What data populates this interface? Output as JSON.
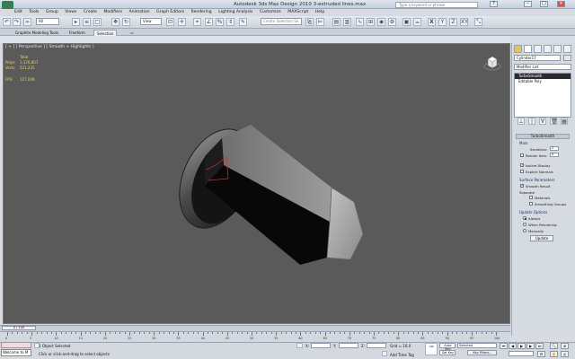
{
  "window": {
    "title": "Autodesk 3ds Max Design 2010     3-extruded lines.max",
    "search_placeholder": "Type a keyword or phrase"
  },
  "menus": [
    "Edit",
    "Tools",
    "Group",
    "Views",
    "Create",
    "Modifiers",
    "Animation",
    "Graph Editors",
    "Rendering",
    "Lighting Analysis",
    "Customize",
    "MAXScript",
    "Help"
  ],
  "toolbar": {
    "filter_value": "All",
    "refcoord_value": "View",
    "named_selection_placeholder": "Create Selection Se",
    "axis_x": "X",
    "axis_y": "Y",
    "axis_z": "Z",
    "axis_xy": "XY"
  },
  "ribbon": {
    "tabs": [
      "Graphite Modeling Tools",
      "Freeform",
      "Selection"
    ]
  },
  "viewport": {
    "label": "[ + ] [ Perspective ] [ Smooth + Highlights ]",
    "stats_total": "Total",
    "stats_polys_label": "Polys:",
    "stats_polys": "1,376,807",
    "stats_verts_label": "Verts:",
    "stats_verts": "521,235",
    "fps_label": "FPS:",
    "fps": "127.049"
  },
  "command_panel": {
    "object_name": "Cylinder17",
    "modifier_list": "Modifier List",
    "stack": [
      "TurboSmooth",
      "Editable Poly"
    ],
    "rollout_title": "TurboSmooth",
    "main_label": "Main",
    "iterations_label": "Iterations:",
    "iterations_value": "2",
    "render_iters_label": "Render Iters:",
    "render_iters_value": "0",
    "isoline_label": "Isoline Display",
    "explicit_normals_label": "Explicit Normals",
    "surface_params_label": "Surface Parameters",
    "smooth_result_label": "Smooth Result",
    "separate_label": "Separate",
    "materials_label": "Materials",
    "smoothing_groups_label": "Smoothing Groups",
    "update_options_label": "Update Options",
    "always_label": "Always",
    "when_rendering_label": "When Rendering",
    "manually_label": "Manually",
    "update_button": "Update"
  },
  "timeline": {
    "slider_label": "0 / 100",
    "ticks": [
      "0",
      "5",
      "10",
      "15",
      "20",
      "25",
      "30",
      "35",
      "40",
      "45",
      "50",
      "55",
      "60",
      "65",
      "70",
      "75",
      "80",
      "85",
      "90",
      "95",
      "100"
    ]
  },
  "status": {
    "maxscript_value": "Welcome to M",
    "selection_status": "1 Object Selected",
    "prompt": "Click or click-and-drag to select objects",
    "x_label": "X:",
    "y_label": "Y:",
    "z_label": "Z:",
    "grid": "Grid = 10.0",
    "add_time_tag": "Add Time Tag",
    "auto_key": "Auto Key",
    "set_key": "Set Key",
    "selected_value": "Selected",
    "key_filters": "Key Filters..."
  }
}
